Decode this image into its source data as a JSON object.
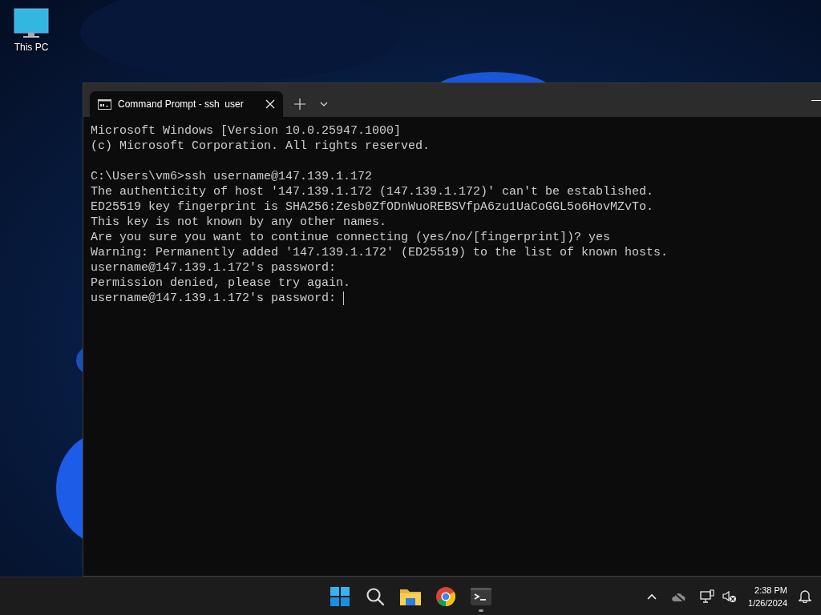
{
  "desktop_icons": [
    {
      "label": "This PC"
    }
  ],
  "window": {
    "tab": {
      "title": "Command Prompt - ssh  user",
      "selected": true
    },
    "blocks": [
      [
        "Microsoft Windows [Version 10.0.25947.1000]",
        "(c) Microsoft Corporation. All rights reserved."
      ],
      [
        "C:\\Users\\vm6>ssh username@147.139.1.172",
        "The authenticity of host '147.139.1.172 (147.139.1.172)' can't be established.",
        "ED25519 key fingerprint is SHA256:Zesb0ZfODnWuoREBSVfpA6zu1UaCoGGL5o6HovMZvTo.",
        "This key is not known by any other names.",
        "Are you sure you want to continue connecting (yes/no/[fingerprint])? yes",
        "Warning: Permanently added '147.139.1.172' (ED25519) to the list of known hosts.",
        "username@147.139.1.172's password:",
        "Permission denied, please try again.",
        "username@147.139.1.172's password: "
      ]
    ],
    "cursor_visible": true
  },
  "taskbar": {
    "apps": [
      {
        "kind": "start",
        "running": false
      },
      {
        "kind": "search",
        "running": false
      },
      {
        "kind": "files",
        "running": false
      },
      {
        "kind": "browser",
        "running": false
      },
      {
        "kind": "terminal",
        "running": true
      }
    ],
    "time": "2:38 PM",
    "date": "1/26/2024"
  }
}
